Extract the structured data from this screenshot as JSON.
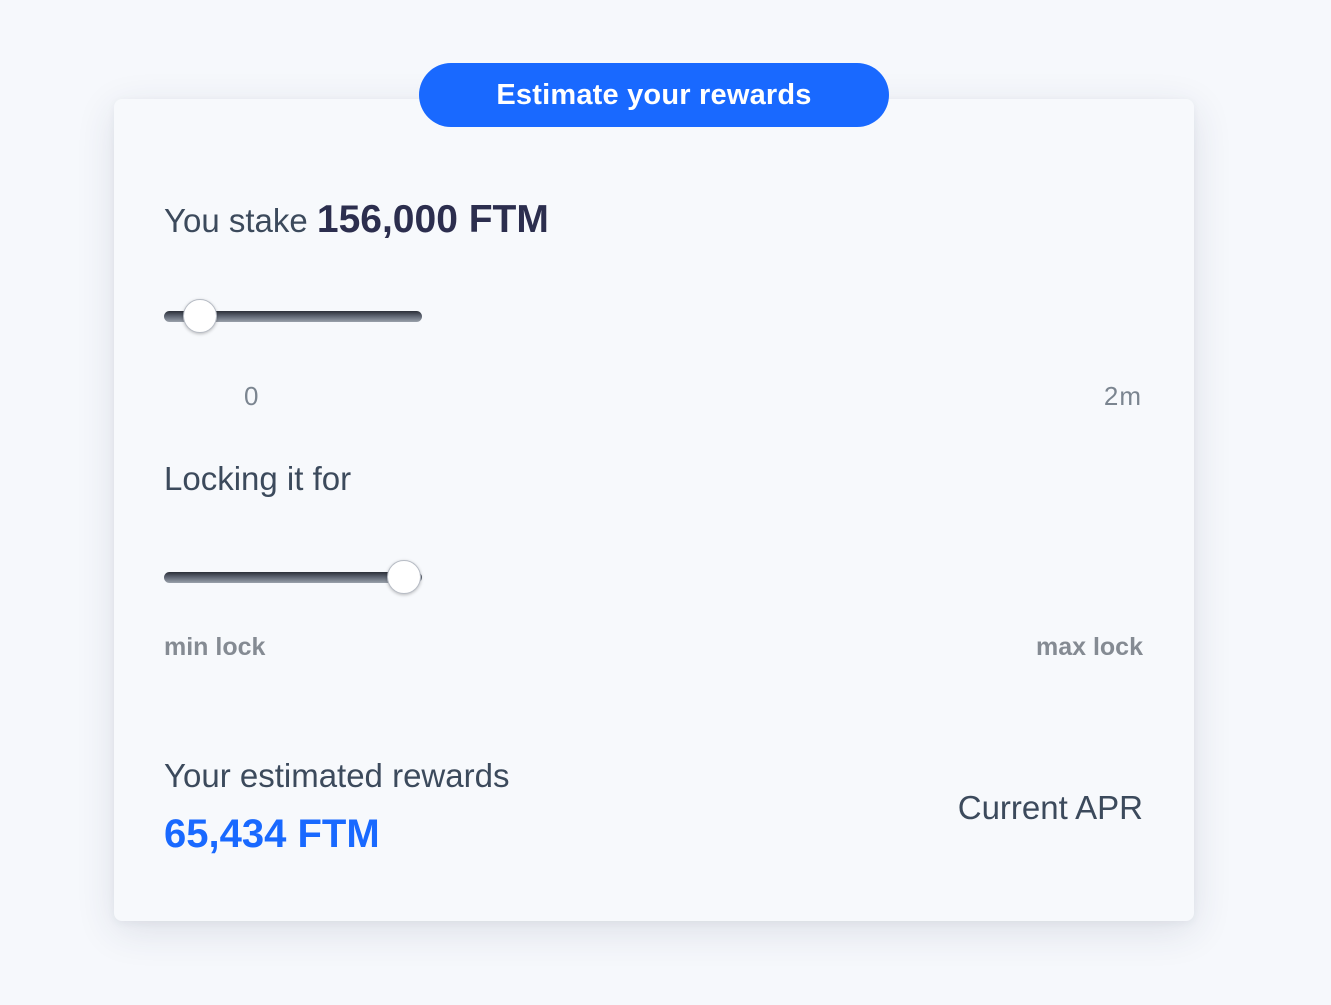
{
  "header": {
    "button_label": "Estimate your rewards"
  },
  "stake": {
    "prefix": "You stake",
    "amount": "156,000 FTM",
    "slider_fraction": 0.14,
    "min_label": "0",
    "max_label": "2m"
  },
  "lock": {
    "title": "Locking it for",
    "slider_fraction": 0.93,
    "min_label": "min lock",
    "max_label": "max lock"
  },
  "rewards": {
    "title": "Your estimated rewards",
    "value": "65,434 FTM",
    "apr_label": "Current APR"
  },
  "colors": {
    "accent": "#1969ff",
    "heading": "#2c2e4e",
    "text": "#3c4a5c",
    "muted": "#858b93"
  }
}
